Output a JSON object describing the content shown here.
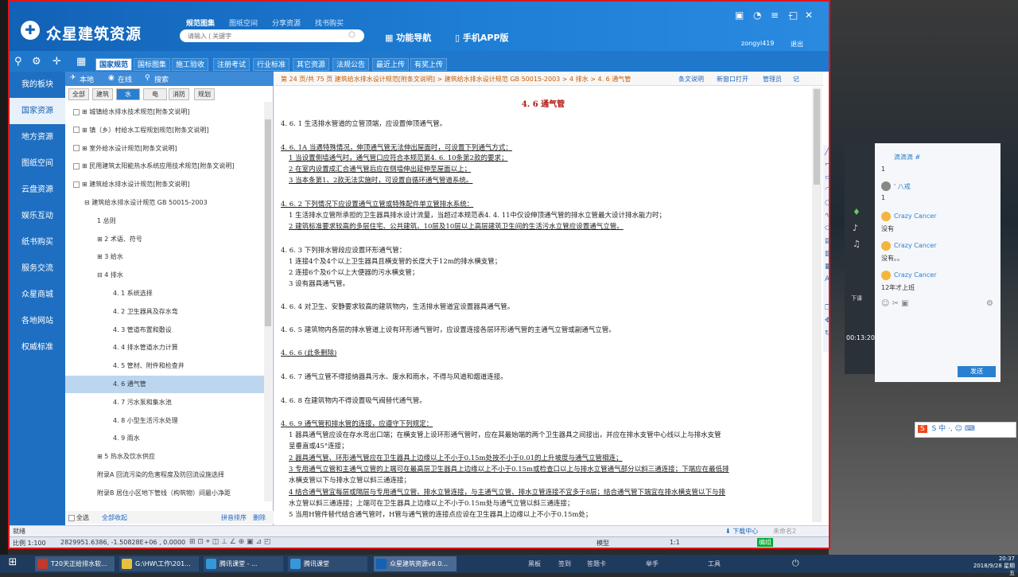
{
  "window": {
    "app_name": "众星建筑资源",
    "top_tabs": [
      "规范图集",
      "图纸空间",
      "分享资源",
      "找书购买"
    ],
    "search_placeholder": "请输入 ( 关键字",
    "nav_button": "功能导航",
    "app_button": "手机APP版",
    "username": "zongyi419",
    "logout": "退出"
  },
  "toolbar": {
    "tabs": [
      "国家规范",
      "国标图集",
      "施工验收",
      "注册考试",
      "行业标准",
      "其它资源",
      "法规公告",
      "最近上传",
      "有奖上传"
    ],
    "active_tab": 0
  },
  "leftnav": {
    "items": [
      "我的板块",
      "国家资源",
      "地方资源",
      "图纸空间",
      "云盘资源",
      "娱乐互动",
      "纸书购买",
      "服务交流",
      "众星商城",
      "各地网站",
      "权威标准"
    ],
    "active": 1
  },
  "tree": {
    "head": [
      "本地",
      "在线",
      "搜索"
    ],
    "cats": [
      "全部",
      "建筑",
      "水",
      "电",
      "消防",
      "规划"
    ],
    "active_cat": 2,
    "items": [
      {
        "text": "城镇给水排水技术规范[附条文说明]",
        "level": 0,
        "check": true
      },
      {
        "text": "镇（乡）村给水工程规划规范[附条文说明]",
        "level": 0,
        "check": true
      },
      {
        "text": "室外给水设计规范[附条文说明]",
        "level": 0,
        "check": true
      },
      {
        "text": "民用建筑太阳能热水系统应用技术规范[附条文说明]",
        "level": 0,
        "check": true
      },
      {
        "text": "建筑给水排水设计规范[附条文说明]",
        "level": 0,
        "check": true
      },
      {
        "text": "建筑给水排水设计规范 GB 50015-2003",
        "level": 1
      },
      {
        "text": "1 总则",
        "level": 2
      },
      {
        "text": "2 术语、符号",
        "level": 2
      },
      {
        "text": "3 给水",
        "level": 2
      },
      {
        "text": "4 排水",
        "level": 2
      },
      {
        "text": "4. 1 系统选择",
        "level": 3
      },
      {
        "text": "4. 2 卫生器具及存水弯",
        "level": 3
      },
      {
        "text": "4. 3 管道布置和敷设",
        "level": 3
      },
      {
        "text": "4. 4 排水管道水力计算",
        "level": 3
      },
      {
        "text": "4. 5 管材、附件和检查井",
        "level": 3
      },
      {
        "text": "4. 6 通气管",
        "level": 3,
        "selected": true
      },
      {
        "text": "4. 7 污水泵和集水池",
        "level": 3
      },
      {
        "text": "4. 8 小型生活污水处理",
        "level": 3
      },
      {
        "text": "4. 9 雨水",
        "level": 3
      },
      {
        "text": "5 热水及饮水供应",
        "level": 2
      },
      {
        "text": "附录A 回流污染的危害程度及防回流设施选择",
        "level": 2
      },
      {
        "text": "附录B 居住小区地下管线（构筑物）间最小净距",
        "level": 2
      }
    ],
    "footer": [
      "全选",
      "全部收起",
      "拼音排序",
      "删除"
    ]
  },
  "content": {
    "crumb": "第 24 页/共 75 页    建筑给水排水设计规范[附条文说明] > 建筑给水排水设计规范 GB 50015-2003 > 4 排水 > 4. 6 通气管",
    "crumb_buttons": [
      "条文说明",
      "新窗口打开",
      "管理员",
      "记"
    ],
    "title": "4. 6 通气管",
    "lines": [
      "4. 6. 1 生活排水管道的立管顶端，应设置伸顶通气管。",
      "4. 6. 1A 当遇特殊情况，伸顶通气管无法伸出屋面时，可设置下列通气方式：",
      "1 当设置侧墙通气时，通气管口应符合本规范第4. 6. 10条第2款的要求；",
      "2 在室内设置成汇合通气管后应在侧墙伸出延伸至屋面以上；",
      "3 当本条第1、2款无法实施时，可设置自循环通气管道系统。",
      "4. 6. 2 下列情况下应设置通气立管或特殊配件单立管排水系统：",
      "1 生活排水立管所承担的卫生器具排水设计流量，当超过本规范表4. 4. 11中仅设伸顶通气管的排水立管最大设计排水能力时；",
      "2 建筑标准要求较高的多层住宅、公共建筑、10层及10层以上高层建筑卫生间的生活污水立管应设置通气立管。",
      "4. 6. 3 下列排水管段应设置环形通气管：",
      "1 连接4个及4个以上卫生器具且横支管的长度大于12m的排水横支管；",
      "2 连接6个及6个以上大便器的污水横支管；",
      "3 设有器具通气管。",
      "4. 6. 4 对卫生、安静要求较高的建筑物内，生活排水管道宜设置器具通气管。",
      "4. 6. 5 建筑物内各层的排水管道上设有环形通气管时，应设置连接各层环形通气管的主通气立管或副通气立管。",
      "4. 6. 6 (此条删除)",
      "4. 6. 7 通气立管不得接纳器具污水、废水和雨水，不得与风道和烟道连接。",
      "4. 6. 8 在建筑物内不得设置吸气阀替代通气管。",
      "4. 6. 9 通气管和排水管的连接，应遵守下列规定：",
      "1 器具通气管应设在存水弯出口端；在横支管上设环形通气管时，应在其最始端的两个卫生器具之间接出，并应在排水支管中心线以上与排水支管",
      "呈垂直或45°连接；",
      "2 器具通气管、环形通气管应在卫生器具上边缘以上不小于0.15m处按不小于0.01的上升坡度与通气立管相连；",
      "3 专用通气立管和主通气立管的上端可在最高层卫生器具上边缘以上不小于0.15m或检查口以上与排水立管通气部分以斜三通连接；下端应在最低排",
      "水横支管以下与排水立管以斜三通连接；",
      "4 结合通气管宜每层或隔层与专用通气立管、排水立管连接，与主通气立管、排水立管连接不宜多于8层；结合通气管下端宜在排水横支管以下与排",
      "水立管以斜三通连接；上端可在卫生器具上边缘以上不小于0.15m处与通气立管以斜三通连接；",
      "5 当用H管件替代结合通气管时，H管与通气管的连接点应设在卫生器具上边缘以上不小于0.15m处；"
    ]
  },
  "status": {
    "ready": "就绪",
    "download_center": "下载中心",
    "sample": "未命名2",
    "scale": "比例 1:100",
    "coords": "2829951.6386, -1.50828E+06 , 0.0000",
    "model": "模型",
    "ratio": "1:1",
    "edit": "编组"
  },
  "chat": {
    "messages": [
      {
        "name": "滴滴滴 #",
        "msg": "1"
      },
      {
        "name": "' 八戒",
        "msg": "1"
      },
      {
        "name": "Crazy Cancer",
        "msg": "没有"
      },
      {
        "name": "Crazy Cancer",
        "msg": "没有。。"
      },
      {
        "name": "Crazy Cancer",
        "msg": "12年才上班"
      }
    ],
    "send": "发送",
    "timer": "00:13:20",
    "down": "下课"
  },
  "taskbar": {
    "tasks": [
      "T20天正给排水软...",
      "G:\\HW\\工作\\201...",
      "腾讯课堂 - ...",
      "腾讯课堂",
      "众星建筑资源v8.0..."
    ],
    "tray": [
      "黑板",
      "签到",
      "答题卡",
      "举手",
      "工具"
    ],
    "time": "20:37",
    "date": "2018/9/28 星期五"
  },
  "ime": "S 中 ·, ☺ ⌨"
}
